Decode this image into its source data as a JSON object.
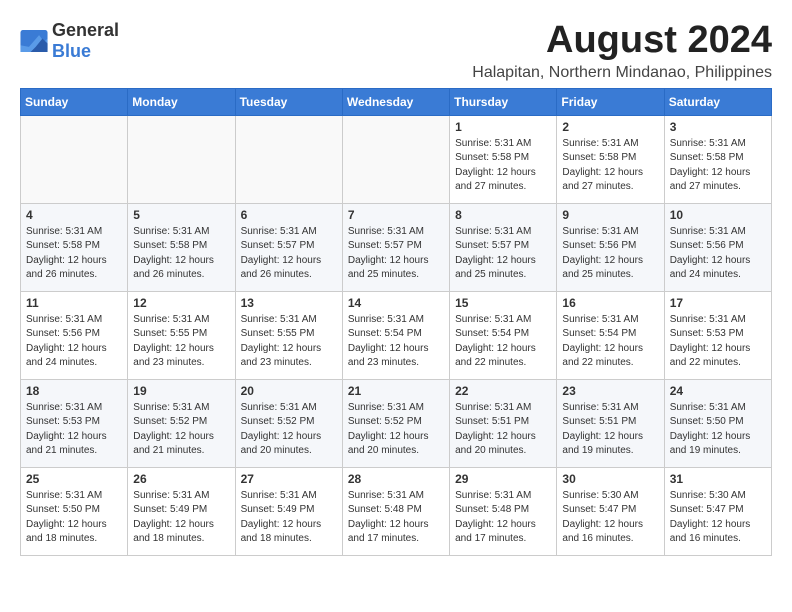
{
  "logo": {
    "general": "General",
    "blue": "Blue"
  },
  "title": {
    "month_year": "August 2024",
    "location": "Halapitan, Northern Mindanao, Philippines"
  },
  "days_of_week": [
    "Sunday",
    "Monday",
    "Tuesday",
    "Wednesday",
    "Thursday",
    "Friday",
    "Saturday"
  ],
  "weeks": [
    [
      {
        "day": "",
        "content": ""
      },
      {
        "day": "",
        "content": ""
      },
      {
        "day": "",
        "content": ""
      },
      {
        "day": "",
        "content": ""
      },
      {
        "day": "1",
        "content": "Sunrise: 5:31 AM\nSunset: 5:58 PM\nDaylight: 12 hours\nand 27 minutes."
      },
      {
        "day": "2",
        "content": "Sunrise: 5:31 AM\nSunset: 5:58 PM\nDaylight: 12 hours\nand 27 minutes."
      },
      {
        "day": "3",
        "content": "Sunrise: 5:31 AM\nSunset: 5:58 PM\nDaylight: 12 hours\nand 27 minutes."
      }
    ],
    [
      {
        "day": "4",
        "content": "Sunrise: 5:31 AM\nSunset: 5:58 PM\nDaylight: 12 hours\nand 26 minutes."
      },
      {
        "day": "5",
        "content": "Sunrise: 5:31 AM\nSunset: 5:58 PM\nDaylight: 12 hours\nand 26 minutes."
      },
      {
        "day": "6",
        "content": "Sunrise: 5:31 AM\nSunset: 5:57 PM\nDaylight: 12 hours\nand 26 minutes."
      },
      {
        "day": "7",
        "content": "Sunrise: 5:31 AM\nSunset: 5:57 PM\nDaylight: 12 hours\nand 25 minutes."
      },
      {
        "day": "8",
        "content": "Sunrise: 5:31 AM\nSunset: 5:57 PM\nDaylight: 12 hours\nand 25 minutes."
      },
      {
        "day": "9",
        "content": "Sunrise: 5:31 AM\nSunset: 5:56 PM\nDaylight: 12 hours\nand 25 minutes."
      },
      {
        "day": "10",
        "content": "Sunrise: 5:31 AM\nSunset: 5:56 PM\nDaylight: 12 hours\nand 24 minutes."
      }
    ],
    [
      {
        "day": "11",
        "content": "Sunrise: 5:31 AM\nSunset: 5:56 PM\nDaylight: 12 hours\nand 24 minutes."
      },
      {
        "day": "12",
        "content": "Sunrise: 5:31 AM\nSunset: 5:55 PM\nDaylight: 12 hours\nand 23 minutes."
      },
      {
        "day": "13",
        "content": "Sunrise: 5:31 AM\nSunset: 5:55 PM\nDaylight: 12 hours\nand 23 minutes."
      },
      {
        "day": "14",
        "content": "Sunrise: 5:31 AM\nSunset: 5:54 PM\nDaylight: 12 hours\nand 23 minutes."
      },
      {
        "day": "15",
        "content": "Sunrise: 5:31 AM\nSunset: 5:54 PM\nDaylight: 12 hours\nand 22 minutes."
      },
      {
        "day": "16",
        "content": "Sunrise: 5:31 AM\nSunset: 5:54 PM\nDaylight: 12 hours\nand 22 minutes."
      },
      {
        "day": "17",
        "content": "Sunrise: 5:31 AM\nSunset: 5:53 PM\nDaylight: 12 hours\nand 22 minutes."
      }
    ],
    [
      {
        "day": "18",
        "content": "Sunrise: 5:31 AM\nSunset: 5:53 PM\nDaylight: 12 hours\nand 21 minutes."
      },
      {
        "day": "19",
        "content": "Sunrise: 5:31 AM\nSunset: 5:52 PM\nDaylight: 12 hours\nand 21 minutes."
      },
      {
        "day": "20",
        "content": "Sunrise: 5:31 AM\nSunset: 5:52 PM\nDaylight: 12 hours\nand 20 minutes."
      },
      {
        "day": "21",
        "content": "Sunrise: 5:31 AM\nSunset: 5:52 PM\nDaylight: 12 hours\nand 20 minutes."
      },
      {
        "day": "22",
        "content": "Sunrise: 5:31 AM\nSunset: 5:51 PM\nDaylight: 12 hours\nand 20 minutes."
      },
      {
        "day": "23",
        "content": "Sunrise: 5:31 AM\nSunset: 5:51 PM\nDaylight: 12 hours\nand 19 minutes."
      },
      {
        "day": "24",
        "content": "Sunrise: 5:31 AM\nSunset: 5:50 PM\nDaylight: 12 hours\nand 19 minutes."
      }
    ],
    [
      {
        "day": "25",
        "content": "Sunrise: 5:31 AM\nSunset: 5:50 PM\nDaylight: 12 hours\nand 18 minutes."
      },
      {
        "day": "26",
        "content": "Sunrise: 5:31 AM\nSunset: 5:49 PM\nDaylight: 12 hours\nand 18 minutes."
      },
      {
        "day": "27",
        "content": "Sunrise: 5:31 AM\nSunset: 5:49 PM\nDaylight: 12 hours\nand 18 minutes."
      },
      {
        "day": "28",
        "content": "Sunrise: 5:31 AM\nSunset: 5:48 PM\nDaylight: 12 hours\nand 17 minutes."
      },
      {
        "day": "29",
        "content": "Sunrise: 5:31 AM\nSunset: 5:48 PM\nDaylight: 12 hours\nand 17 minutes."
      },
      {
        "day": "30",
        "content": "Sunrise: 5:30 AM\nSunset: 5:47 PM\nDaylight: 12 hours\nand 16 minutes."
      },
      {
        "day": "31",
        "content": "Sunrise: 5:30 AM\nSunset: 5:47 PM\nDaylight: 12 hours\nand 16 minutes."
      }
    ]
  ]
}
